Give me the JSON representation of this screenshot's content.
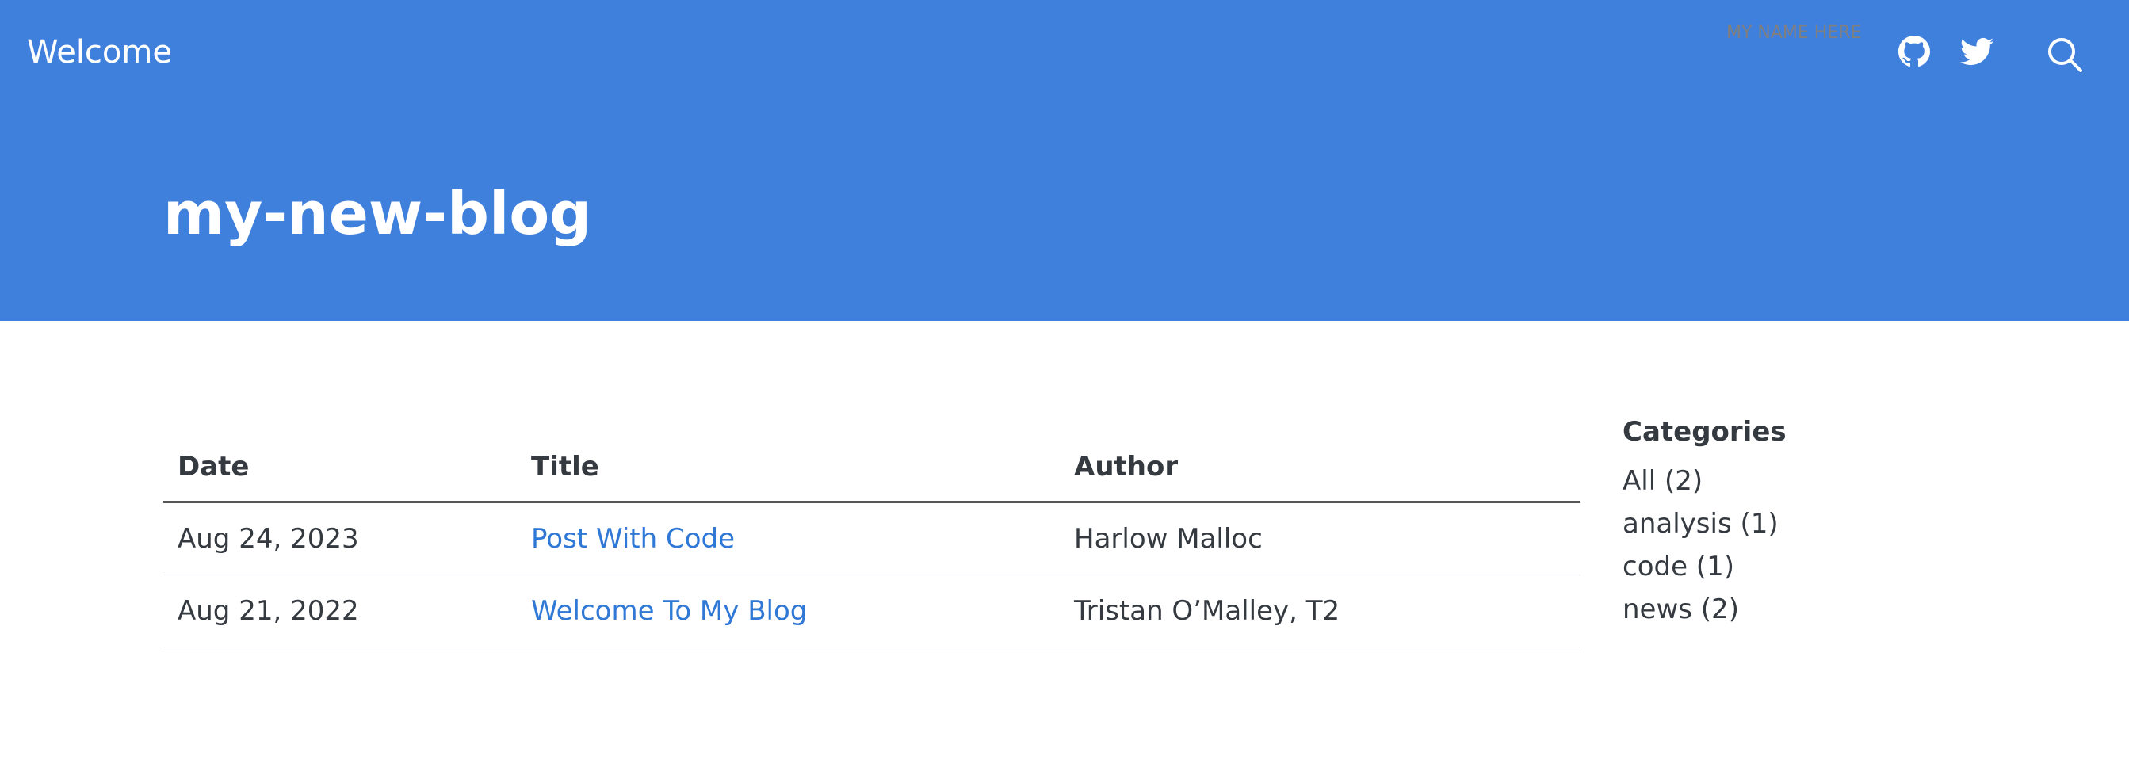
{
  "theme": {
    "brand_color": "#4080DD",
    "accent_color": "#2F78D6"
  },
  "navbar": {
    "brand": "Welcome",
    "name_placeholder": "MY NAME HERE",
    "icons": [
      "github-icon",
      "twitter-icon",
      "search-icon"
    ]
  },
  "header": {
    "title": "my-new-blog"
  },
  "listing": {
    "columns": {
      "date": "Date",
      "title": "Title",
      "author": "Author"
    },
    "rows": [
      {
        "date": "Aug 24, 2023",
        "title": "Post With Code",
        "author": "Harlow Malloc"
      },
      {
        "date": "Aug 21, 2022",
        "title": "Welcome To My Blog",
        "author": "Tristan O’Malley, T2"
      }
    ]
  },
  "sidebar": {
    "heading": "Categories",
    "categories": [
      "All (2)",
      "analysis (1)",
      "code (1)",
      "news (2)"
    ]
  }
}
